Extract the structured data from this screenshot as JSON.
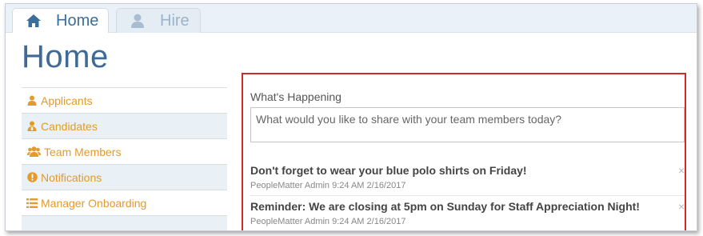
{
  "tabs": [
    {
      "label": "Home",
      "icon": "home-icon",
      "active": true
    },
    {
      "label": "Hire",
      "icon": "user-icon",
      "active": false
    }
  ],
  "page": {
    "title": "Home"
  },
  "sidebar": {
    "items": [
      {
        "label": "Applicants",
        "icon": "user-icon"
      },
      {
        "label": "Candidates",
        "icon": "candidate-icon"
      },
      {
        "label": "Team Members",
        "icon": "users-icon"
      },
      {
        "label": "Notifications",
        "icon": "exclamation-circle-icon"
      },
      {
        "label": "Manager Onboarding",
        "icon": "list-icon"
      }
    ]
  },
  "whats_happening": {
    "heading": "What's Happening",
    "input_placeholder": "What would you like to share with your team members today?",
    "posts": [
      {
        "message": "Don't forget to wear your blue polo shirts on Friday!",
        "meta": "PeopleMatter Admin 9:24 AM 2/16/2017",
        "close": "×"
      },
      {
        "message": "Reminder: We are closing at 5pm on Sunday for Staff Appreciation Night!",
        "meta": "PeopleMatter Admin 9:24 AM 2/16/2017",
        "close": "×"
      }
    ]
  },
  "colors": {
    "accent_orange": "#e49a2c",
    "title_blue": "#3e6a95",
    "highlight_red": "#cf2a2a"
  }
}
